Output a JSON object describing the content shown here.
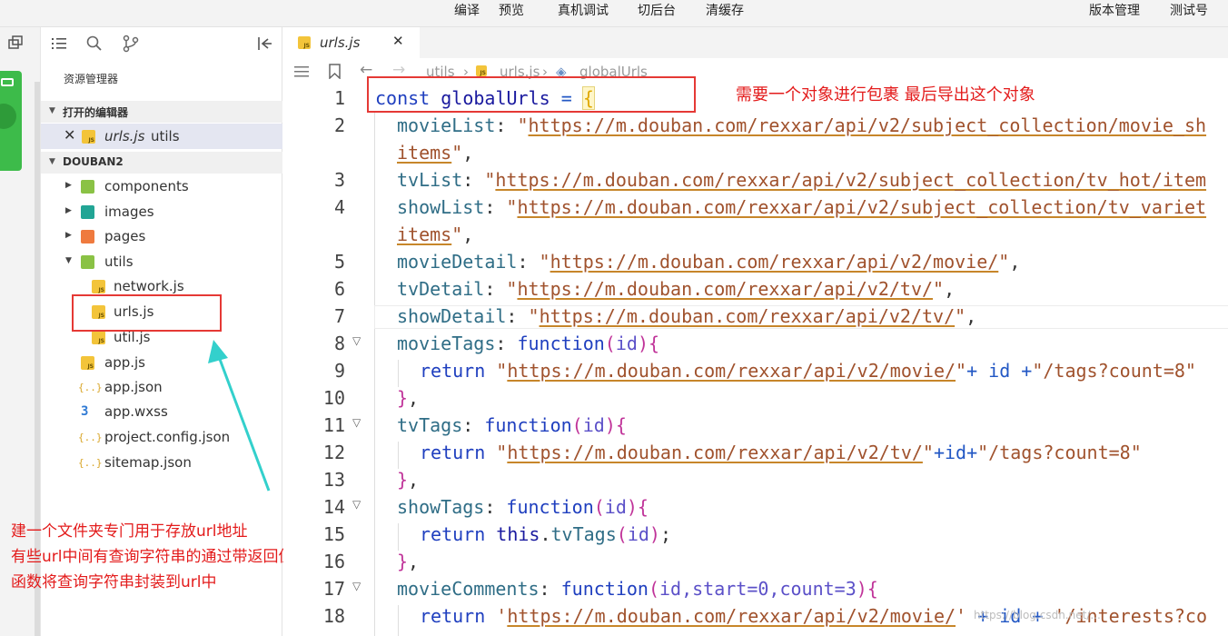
{
  "menu": {
    "compile": "编译",
    "preview": "预览",
    "debug": "真机调试",
    "background": "切后台",
    "clear_cache": "清缓存",
    "version": "版本管理",
    "test_account": "测试号"
  },
  "explorer": {
    "title": "资源管理器",
    "open_editors": "打开的编辑器",
    "open_file_name": "urls.js",
    "open_file_dir": "utils",
    "project": "DOUBAN2",
    "items": [
      {
        "label": "components"
      },
      {
        "label": "images"
      },
      {
        "label": "pages"
      },
      {
        "label": "utils"
      },
      {
        "label": "network.js"
      },
      {
        "label": "urls.js"
      },
      {
        "label": "util.js"
      },
      {
        "label": "app.js"
      },
      {
        "label": "app.json"
      },
      {
        "label": "app.wxss"
      },
      {
        "label": "project.config.json"
      },
      {
        "label": "sitemap.json"
      }
    ]
  },
  "editor": {
    "tab": "urls.js",
    "breadcrumb": [
      "utils",
      "urls.js",
      "globalUrls"
    ]
  },
  "code": {
    "line_numbers": [
      "1",
      "2",
      "3",
      "4",
      "5",
      "6",
      "7",
      "8",
      "9",
      "10",
      "11",
      "12",
      "13",
      "14",
      "15",
      "16",
      "17",
      "18"
    ],
    "l1": {
      "kw": "const",
      "def": "globalUrls",
      "op": "=",
      "br": "{"
    },
    "l2": {
      "key": "movieList",
      "url": "https://m.douban.com/rexxar/api/v2/subject_collection/movie_sh",
      "wrap": "items"
    },
    "l3": {
      "key": "tvList",
      "url": "https://m.douban.com/rexxar/api/v2/subject_collection/tv_hot/item"
    },
    "l4": {
      "key": "showList",
      "url": "https://m.douban.com/rexxar/api/v2/subject_collection/tv_variet",
      "wrap": "items"
    },
    "l5": {
      "key": "movieDetail",
      "url": "https://m.douban.com/rexxar/api/v2/movie/"
    },
    "l6": {
      "key": "tvDetail",
      "url": "https://m.douban.com/rexxar/api/v2/tv/"
    },
    "l7": {
      "key": "showDetail",
      "url": "https://m.douban.com/rexxar/api/v2/tv/"
    },
    "l8": {
      "key": "movieTags",
      "fn": "function",
      "args": "id"
    },
    "l9": {
      "ret": "return",
      "url": "https://m.douban.com/rexxar/api/v2/movie/",
      "mid": "+ id +",
      "tail": "\"/tags?count=8\""
    },
    "l11": {
      "key": "tvTags",
      "fn": "function",
      "args": "id"
    },
    "l12": {
      "ret": "return",
      "url": "https://m.douban.com/rexxar/api/v2/tv/",
      "mid": "+id+",
      "tail": "\"/tags?count=8\""
    },
    "l14": {
      "key": "showTags",
      "fn": "function",
      "args": "id"
    },
    "l15": {
      "ret": "return",
      "this": "this",
      "call": "tvTags",
      "args": "id"
    },
    "l17": {
      "key": "movieComments",
      "fn": "function",
      "args": "id,start=0,count=3"
    },
    "l18": {
      "ret": "return",
      "url": "https://m.douban.com/rexxar/api/v2/movie/",
      "mid": "+ id +",
      "tail": "'/interests?co"
    }
  },
  "annotations": {
    "top": "需要一个对象进行包裹  最后导出这个对象",
    "left_line1": "建一个文件夹专门用于存放url地址",
    "left_line2": "有些url中间有查询字符串的通过带返回值的",
    "left_line3": "函数将查询字符串封装到url中"
  },
  "watermark": "https://blog.csdn.net/..."
}
